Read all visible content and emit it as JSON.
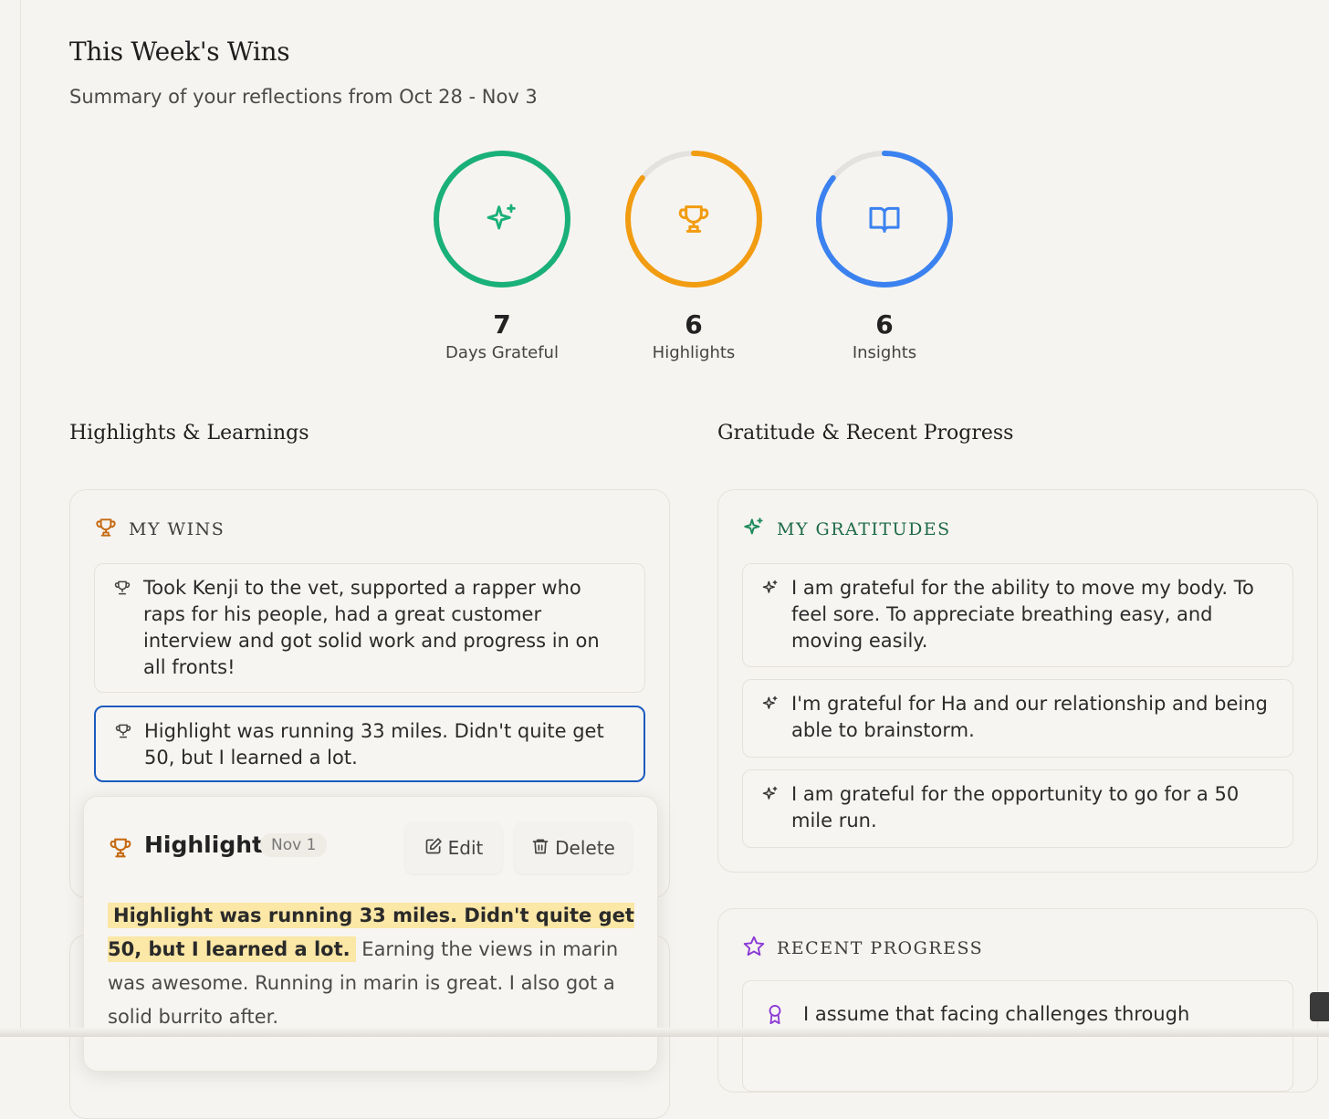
{
  "header": {
    "title": "This Week's Wins",
    "subtitle": "Summary of your reflections from Oct 28 - Nov 3"
  },
  "stats": [
    {
      "value": "7",
      "label": "Days Grateful",
      "color": "#19b07a",
      "icon": "sparkles-icon",
      "progress": 1.0
    },
    {
      "value": "6",
      "label": "Highlights",
      "color": "#f29c11",
      "icon": "trophy-icon",
      "progress": 0.857
    },
    {
      "value": "6",
      "label": "Insights",
      "color": "#3b82f0",
      "icon": "book-icon",
      "progress": 0.857
    }
  ],
  "sections": {
    "left_heading": "Highlights & Learnings",
    "right_heading": "Gratitude & Recent Progress"
  },
  "wins": {
    "label": "MY WINS",
    "color": "#c56a12",
    "items": [
      "Took Kenji to the vet, supported a rapper who raps for his people, had a great customer interview and got solid work and progress in on all fronts!",
      "Highlight was running 33 miles. Didn't quite get 50, but I learned a lot."
    ]
  },
  "gratitudes": {
    "label": "MY GRATITUDES",
    "color": "#1d6b47",
    "items": [
      "I am grateful for the ability to move my body. To feel sore. To appreciate breathing easy, and moving easily.",
      "I'm grateful for Ha and our relationship and being able to brainstorm.",
      "I am grateful for the opportunity to go for a 50 mile run."
    ]
  },
  "progress": {
    "label": "RECENT PROGRESS",
    "color": "#8b3ad6",
    "items": [
      "I assume that facing challenges through"
    ]
  },
  "popup": {
    "title": "Highlight",
    "date": "Nov 1",
    "edit_label": "Edit",
    "delete_label": "Delete",
    "highlight_text": "Highlight was running 33 miles. Didn't quite get 50, but I learned a lot.",
    "rest_text": "Earning the views in marin was awesome. Running in marin is great. I also got a solid burrito after."
  }
}
